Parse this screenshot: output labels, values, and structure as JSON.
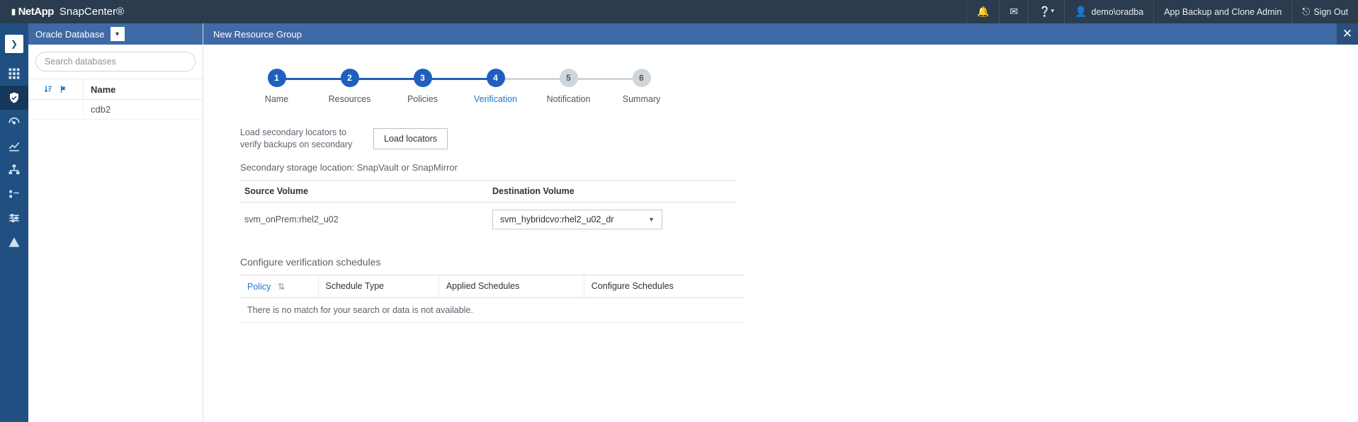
{
  "brand": {
    "company": "NetApp",
    "product": "SnapCenter®"
  },
  "topbar": {
    "help_label": "?",
    "user": "demo\\oradba",
    "role": "App Backup and Clone Admin",
    "signout": "Sign Out"
  },
  "left_panel": {
    "title": "Oracle Database",
    "search_placeholder": "Search databases",
    "name_header": "Name",
    "items": [
      "cdb2"
    ]
  },
  "rail": {
    "items": [
      "dashboard",
      "resources",
      "monitor",
      "reports",
      "hosts",
      "storage",
      "settings",
      "alerts"
    ],
    "active_index": 1
  },
  "main": {
    "title": "New Resource Group",
    "steps": [
      {
        "num": "1",
        "label": "Name",
        "state": "done"
      },
      {
        "num": "2",
        "label": "Resources",
        "state": "done"
      },
      {
        "num": "3",
        "label": "Policies",
        "state": "done"
      },
      {
        "num": "4",
        "label": "Verification",
        "state": "active"
      },
      {
        "num": "5",
        "label": "Notification",
        "state": "pending"
      },
      {
        "num": "6",
        "label": "Summary",
        "state": "pending"
      }
    ],
    "load_text": "Load secondary locators to verify backups on secondary",
    "load_button": "Load locators",
    "secondary_title": "Secondary storage location: SnapVault or SnapMirror",
    "vol_table": {
      "headers": [
        "Source Volume",
        "Destination Volume"
      ],
      "rows": [
        {
          "source": "svm_onPrem:rhel2_u02",
          "dest": "svm_hybridcvo:rhel2_u02_dr"
        }
      ]
    },
    "sched_title": "Configure verification schedules",
    "sched_headers": [
      "Policy",
      "Schedule Type",
      "Applied Schedules",
      "Configure Schedules"
    ],
    "sched_empty": "There is no match for your search or data is not available."
  }
}
